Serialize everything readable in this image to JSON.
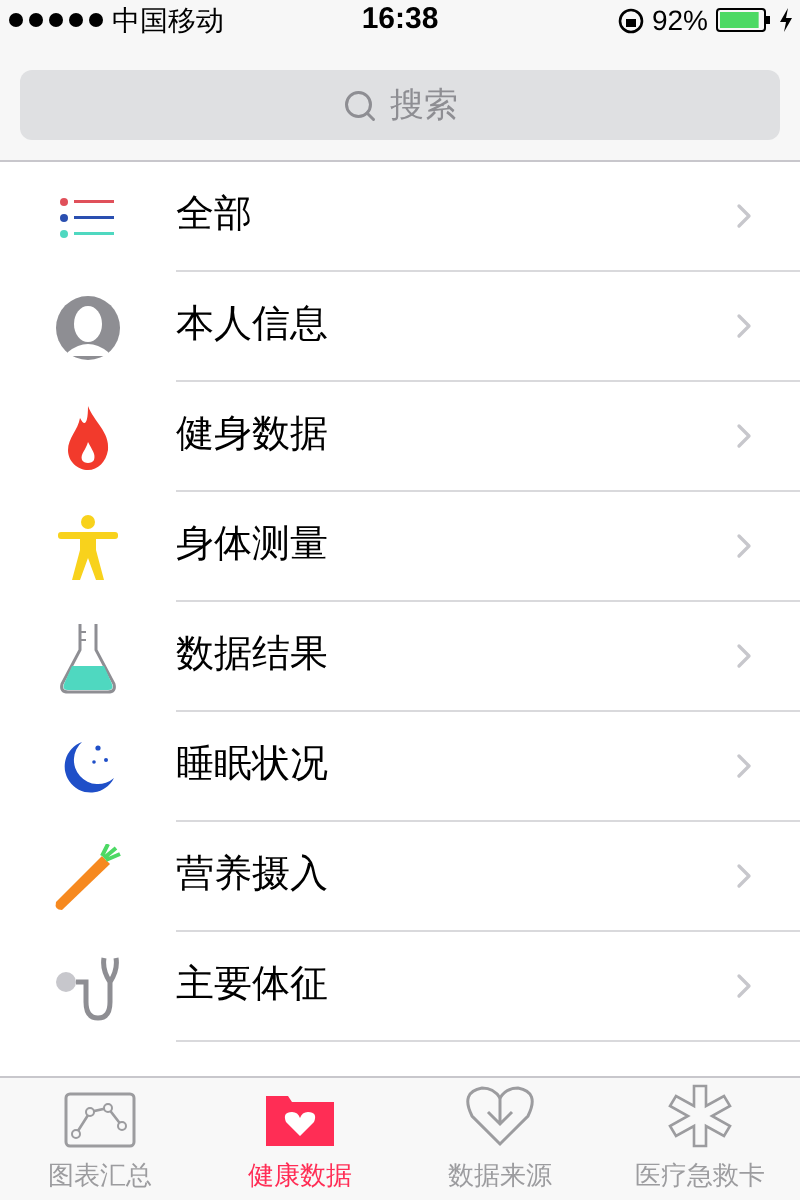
{
  "status_bar": {
    "carrier": "中国移动",
    "time": "16:38",
    "battery": "92%",
    "charging": true
  },
  "search": {
    "placeholder": "搜索"
  },
  "items": [
    {
      "label": "全部"
    },
    {
      "label": "本人信息"
    },
    {
      "label": "健身数据"
    },
    {
      "label": "身体测量"
    },
    {
      "label": "数据结果"
    },
    {
      "label": "睡眠状况"
    },
    {
      "label": "营养摄入"
    },
    {
      "label": "主要体征"
    }
  ],
  "tabs": [
    {
      "label": "图表汇总",
      "selected": false
    },
    {
      "label": "健康数据",
      "selected": true
    },
    {
      "label": "数据来源",
      "selected": false
    },
    {
      "label": "医疗急救卡",
      "selected": false
    }
  ]
}
